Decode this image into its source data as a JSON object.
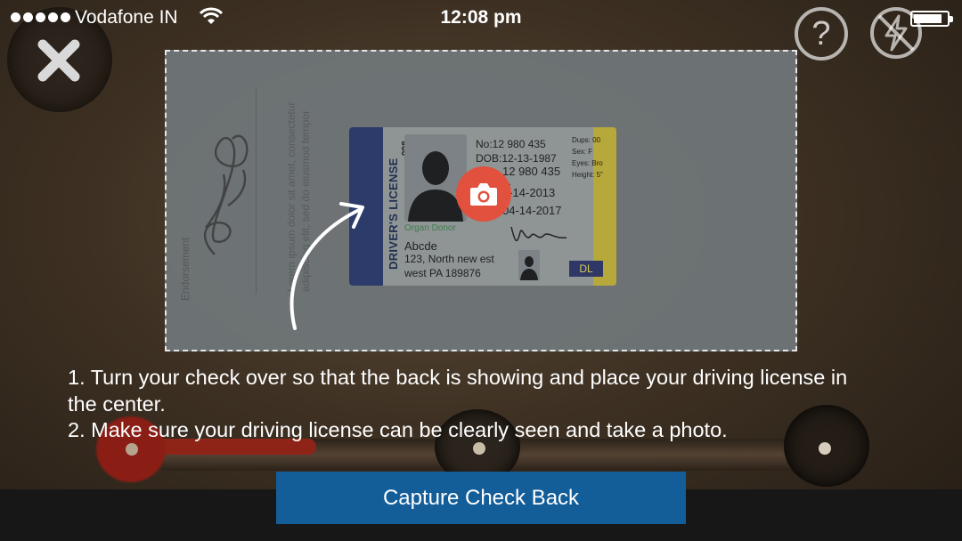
{
  "status_bar": {
    "carrier": "Vodafone IN",
    "time": "12:08 pm",
    "signal_icon": "signal-dots-icon",
    "wifi_icon": "wifi-icon",
    "battery_icon": "battery-icon",
    "battery_level": 0.85
  },
  "toolbar": {
    "close_icon": "close-icon",
    "help_icon": "help-icon",
    "help_label": "?",
    "flash_icon": "flash-off-icon"
  },
  "check_back": {
    "endorsement_label": "Endorsement",
    "lorem_text": "Lorem ipsum dolor sit amet, consectetur adipiscing elit, sed do eiusmod tempor"
  },
  "license": {
    "title": "DRIVER'S LICENSE",
    "vertical_number": "098",
    "no": "No:12 980 435",
    "dob": "DOB:12-13-1987",
    "id_line": "12 980 435",
    "ellipsis": "...",
    "issued": "2-14-2013",
    "expires": "04-14-2017",
    "dups": "Dups: 00",
    "sex": "Sex: F",
    "eyes": "Eyes: Bro",
    "height": "Height: 5\"",
    "organ_donor": "Organ Donor",
    "name": "Abcde",
    "address_line1": "123, North new est",
    "address_line2": "west PA 189876",
    "badge": "DL"
  },
  "camera_icon": "camera-icon",
  "arrow_icon": "curved-arrow-icon",
  "instructions": {
    "line1": "1. Turn your check over so that the back is showing and place your driving license in the center.",
    "line2": "2. Make sure your driving license can be clearly seen and take a photo."
  },
  "capture_button": {
    "label": "Capture Check Back"
  },
  "colors": {
    "button_blue": "#135d99",
    "camera_red": "#e1513d",
    "license_blue": "#2c3b6a",
    "license_gold": "#b6a83a"
  }
}
